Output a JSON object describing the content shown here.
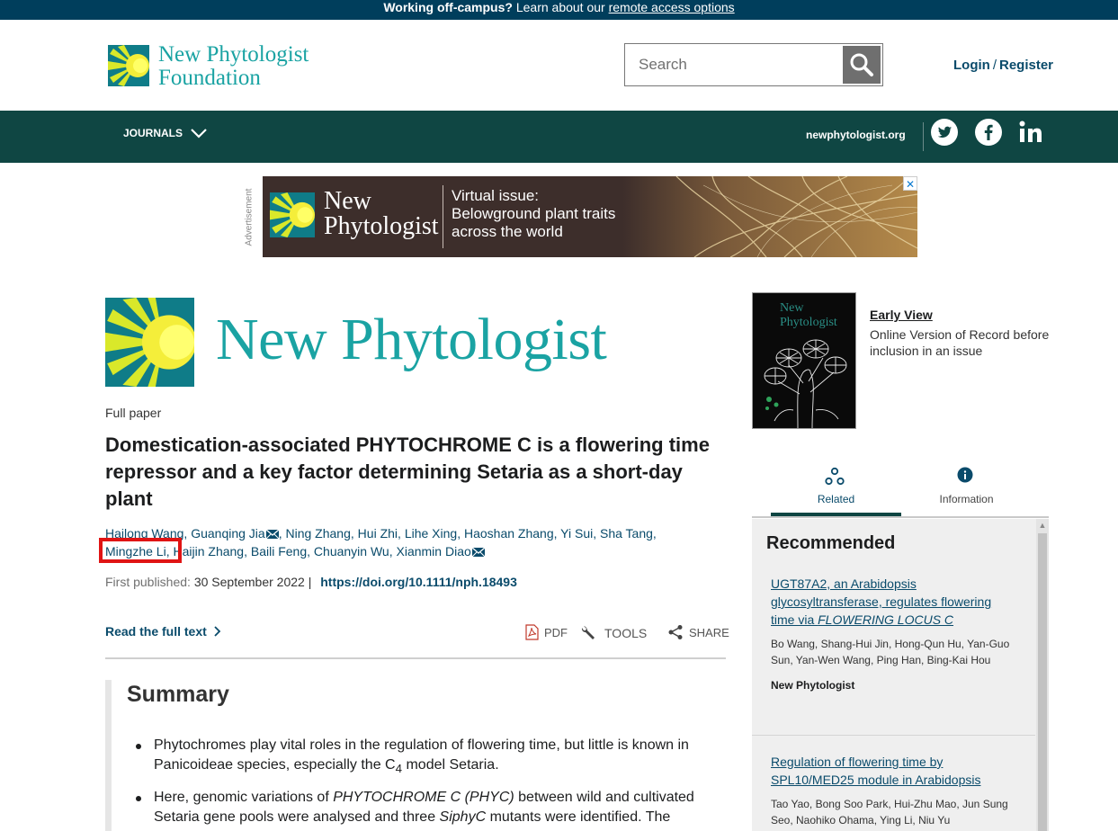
{
  "banner": {
    "prefix": "Working off-campus?",
    "middle": " Learn about our ",
    "link": "remote access options"
  },
  "header": {
    "logo_line1": "New Phytologist",
    "logo_line2": "Foundation",
    "search_placeholder": "Search",
    "login": "Login",
    "sep": "/",
    "register": "Register"
  },
  "nav": {
    "journals": "JOURNALS",
    "site": "newphytologist.org"
  },
  "ad": {
    "label": "Advertisement",
    "brand_line1": "New",
    "brand_line2": "Phytologist",
    "line1": "Virtual issue:",
    "line2": "Belowground plant traits",
    "line3": "across the world",
    "close": "✕"
  },
  "journal": {
    "title": "New Phytologist"
  },
  "article": {
    "type": "Full paper",
    "title": "Domestication-associated PHYTOCHROME C is a flowering time repressor and a key factor determining Setaria as a short-day plant",
    "authors": [
      "Hailong Wang",
      "Guanqing Jia",
      "Ning Zhang",
      "Hui Zhi",
      "Lihe Xing",
      "Haoshan Zhang",
      "Yi Sui",
      "Sha Tang",
      "Mingzhe Li",
      "Haijin Zhang",
      "Baili Feng",
      "Chuanyin Wu",
      "Xianmin Diao"
    ],
    "first_published_label": "First published:",
    "first_published_date": "30 September 2022",
    "sep": "|",
    "doi": "https://doi.org/10.1111/nph.18493",
    "read_full": "Read the full text",
    "pdf": "PDF",
    "tools": "TOOLS",
    "share": "SHARE"
  },
  "summary": {
    "heading": "Summary",
    "b1_part1": "Phytochromes play vital roles in the regulation of flowering time, but little is known in Panicoideae species, especially the C",
    "b1_sub": "4",
    "b1_part2": " model Setaria.",
    "b2_part1": "Here, genomic variations of ",
    "b2_em1": "PHYTOCHROME C (PHYC)",
    "b2_part2": " between wild and cultivated Setaria gene pools were analysed and three ",
    "b2_em2": "SiphyC",
    "b2_part3": " mutants were identified. The"
  },
  "sidebar": {
    "early_view": "Early View",
    "early_desc": "Online Version of Record before inclusion in an issue",
    "tab_related": "Related",
    "tab_information": "Information",
    "recommended_heading": "Recommended",
    "rec1": {
      "title_part": "UGT87A2, an Arabidopsis glycosyltransferase, regulates flowering time via ",
      "title_em": "FLOWERING LOCUS C",
      "authors": "Bo Wang, Shang-Hui Jin, Hong-Qun Hu, Yan-Guo Sun, Yan-Wen Wang, Ping Han, Bing-Kai Hou",
      "journal": "New Phytologist"
    },
    "rec2": {
      "title": "Regulation of flowering time by SPL10/MED25 module in Arabidopsis",
      "authors": "Tao Yao, Bong Soo Park, Hui-Zhu Mao, Jun Sung Seo, Naohiko Ohama, Ying Li, Niu Yu"
    }
  },
  "colors": {
    "banner_bg": "#003e5c",
    "nav_bg": "#0f4643",
    "teal": "#1aa3a3",
    "link": "#0a4b6b",
    "highlight": "#e01414"
  }
}
